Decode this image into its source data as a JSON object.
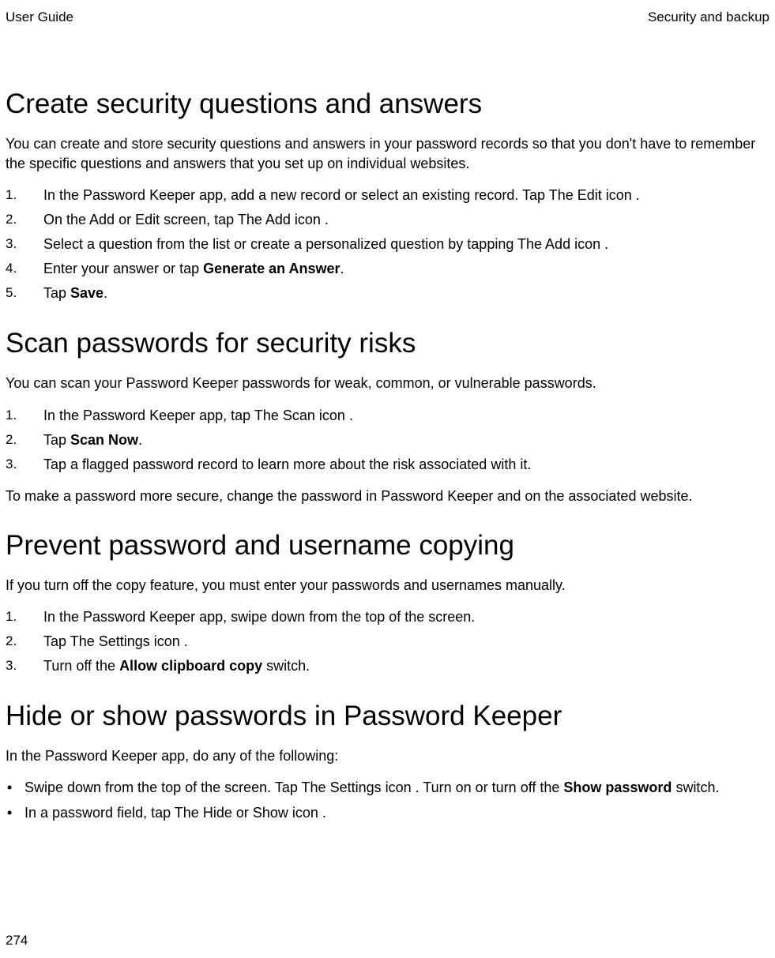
{
  "header": {
    "left": "User Guide",
    "right": "Security and backup"
  },
  "section1": {
    "heading": "Create security questions and answers",
    "intro": "You can create and store security questions and answers in your password records so that you don't have to remember the specific questions and answers that you set up on individual websites.",
    "steps": [
      {
        "pre": "In the Password Keeper app, add a new record or select an existing record. Tap  ",
        "icon": "The Edit icon",
        "post": " ."
      },
      {
        "pre": "On the Add or Edit screen, tap  ",
        "icon": "The Add icon",
        "post": " ."
      },
      {
        "pre": "Select a question from the list or create a personalized question by tapping  ",
        "icon": "The Add icon",
        "post": " ."
      },
      {
        "pre": "Enter your answer or tap ",
        "bold": "Generate an Answer",
        "post": "."
      },
      {
        "pre": "Tap ",
        "bold": "Save",
        "post": "."
      }
    ]
  },
  "section2": {
    "heading": "Scan passwords for security risks",
    "intro": "You can scan your Password Keeper passwords for weak, common, or vulnerable passwords.",
    "steps": [
      {
        "pre": "In the Password Keeper app, tap  ",
        "icon": "The Scan icon",
        "post": " ."
      },
      {
        "pre": "Tap ",
        "bold": "Scan Now",
        "post": "."
      },
      {
        "pre": "Tap a flagged password record to learn more about the risk associated with it."
      }
    ],
    "after": "To make a password more secure, change the password in Password Keeper and on the associated website."
  },
  "section3": {
    "heading": "Prevent password and username copying",
    "intro": "If you turn off the copy feature, you must enter your passwords and usernames manually.",
    "steps": [
      {
        "pre": "In the Password Keeper app, swipe down from the top of the screen."
      },
      {
        "pre": "Tap  ",
        "icon": "The Settings icon",
        "post": " ."
      },
      {
        "pre": "Turn off the ",
        "bold": "Allow clipboard copy",
        "post": " switch."
      }
    ]
  },
  "section4": {
    "heading": "Hide or show passwords in Password Keeper",
    "intro": "In the Password Keeper app, do any of the following:",
    "bullets": [
      {
        "pre": "Swipe down from the top of the screen. Tap  ",
        "icon": "The Settings icon",
        "mid": " . Turn on or turn off the ",
        "bold": "Show password",
        "post": " switch."
      },
      {
        "pre": "In a password field, tap  ",
        "icon": "The Hide or Show icon",
        "post": " ."
      }
    ]
  },
  "pageNumber": "274"
}
